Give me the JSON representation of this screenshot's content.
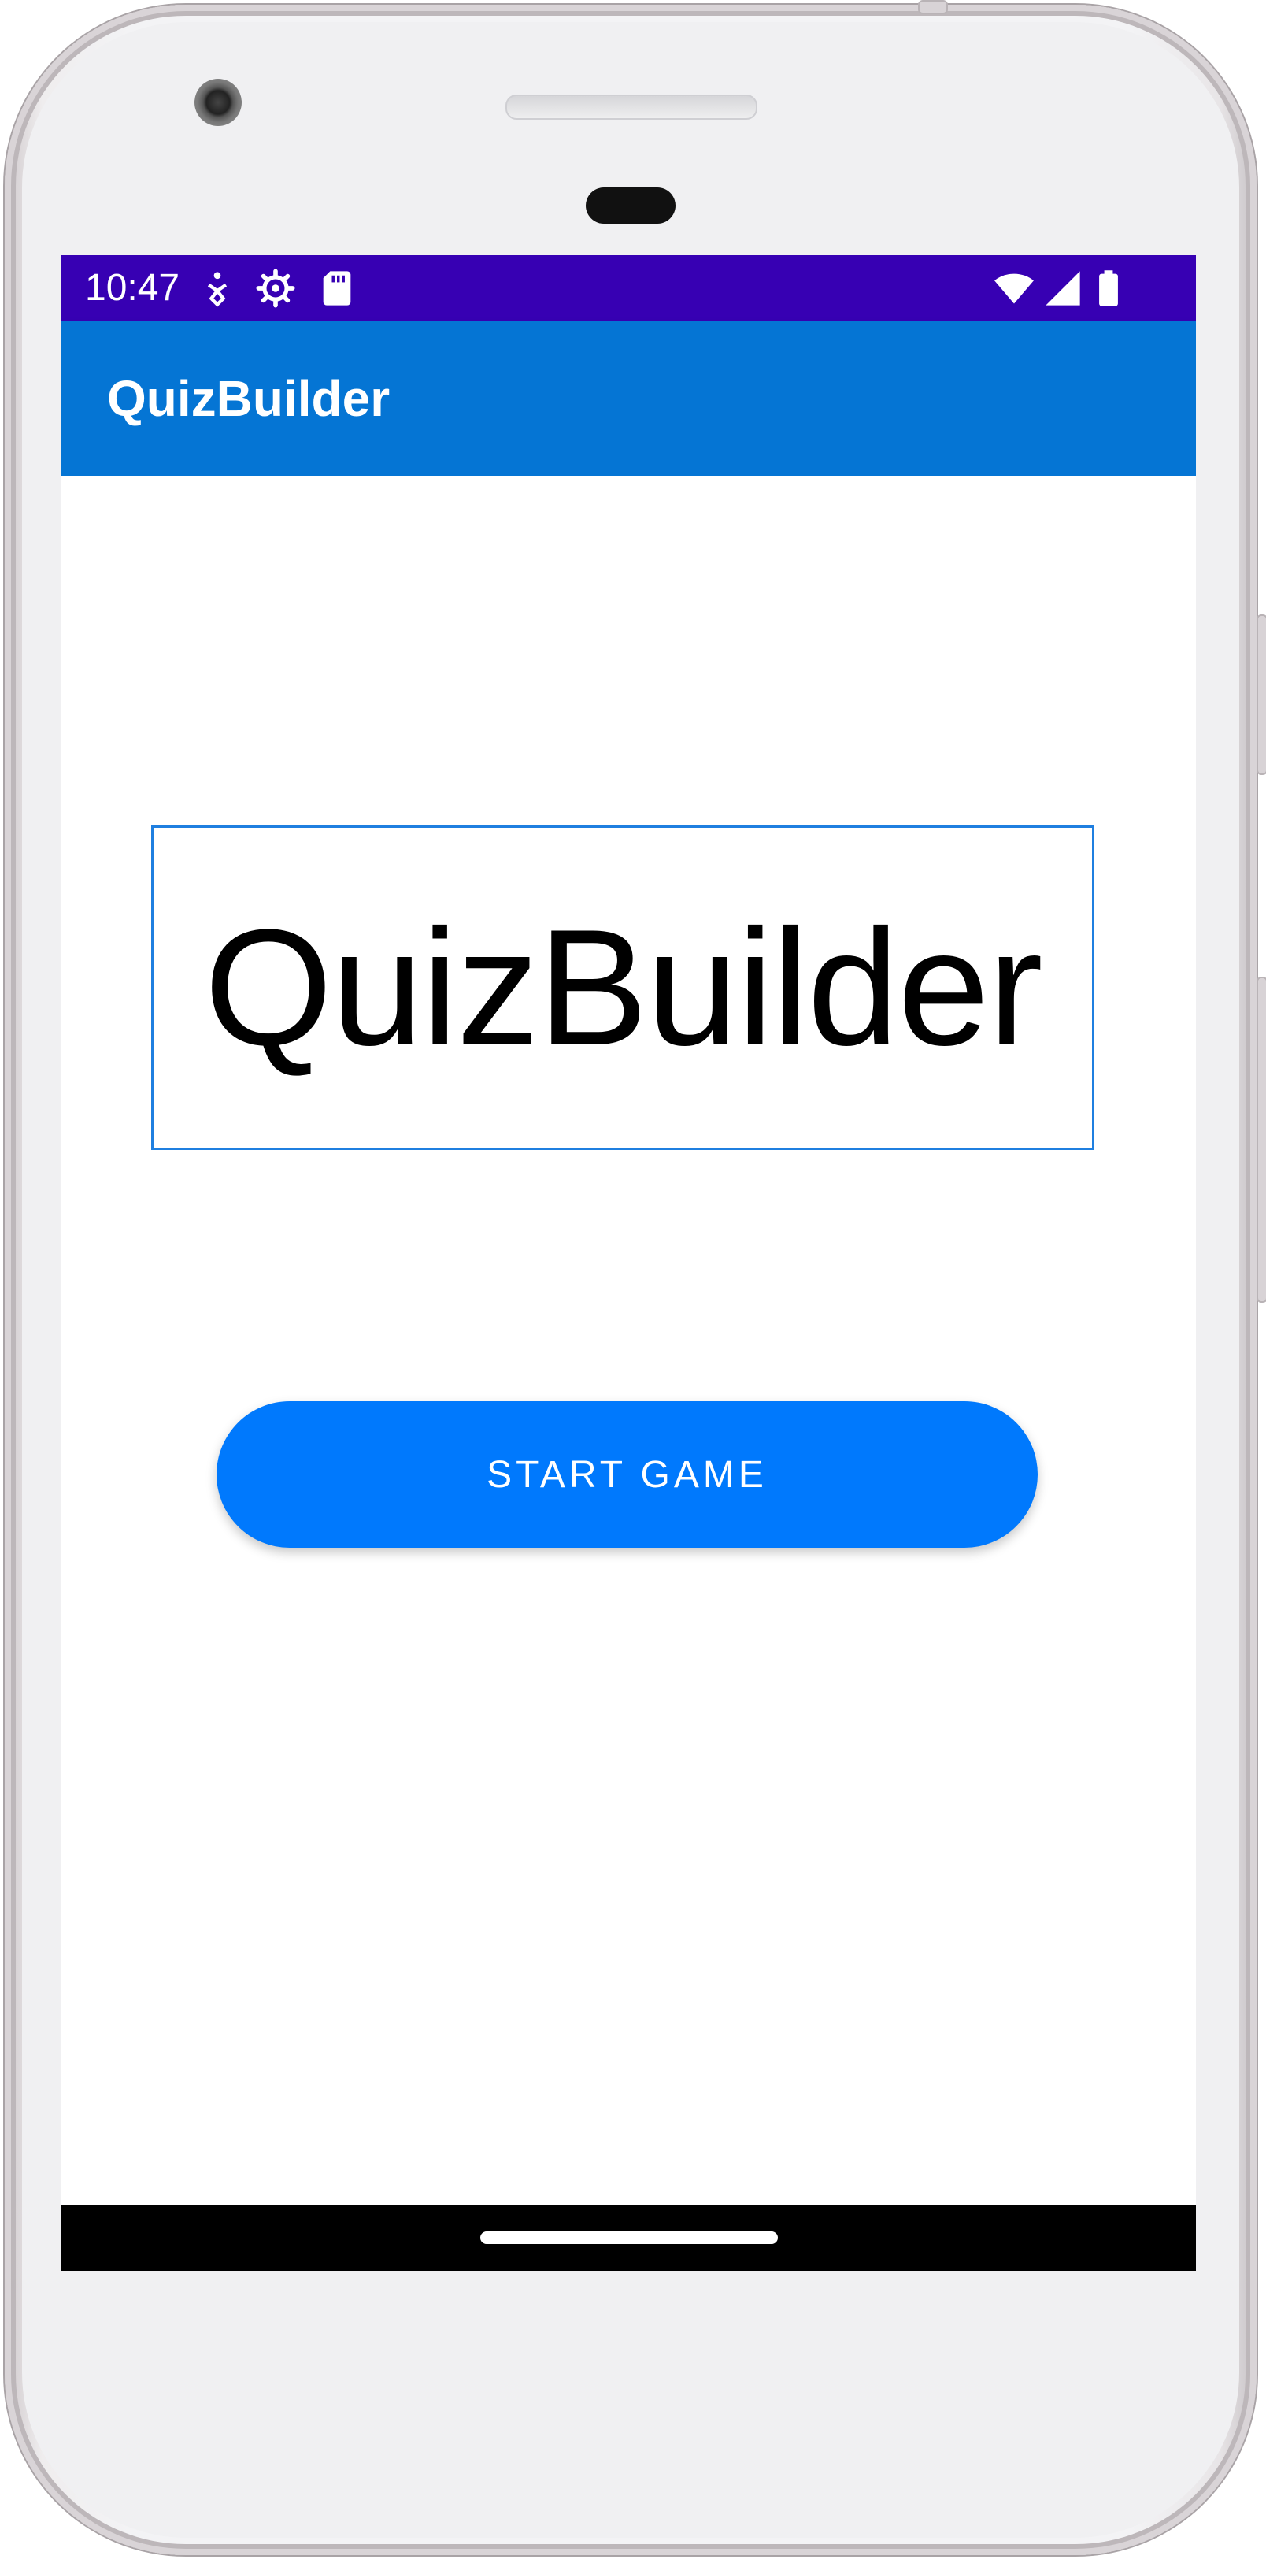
{
  "status_bar": {
    "time": "10:47",
    "left_icons": [
      "accessibility-icon",
      "settings-gear-icon",
      "sd-card-icon"
    ],
    "right_icons": [
      "wifi-icon",
      "cellular-signal-icon",
      "battery-icon"
    ],
    "background_color": "#3700b3"
  },
  "app_bar": {
    "title": "QuizBuilder",
    "background_color": "#0575d4"
  },
  "main": {
    "logo_text": "QuizBuilder",
    "start_button_label": "START GAME",
    "accent_color": "#0079fd"
  },
  "nav_bar": {
    "home_indicator": "home-gesture-pill"
  }
}
